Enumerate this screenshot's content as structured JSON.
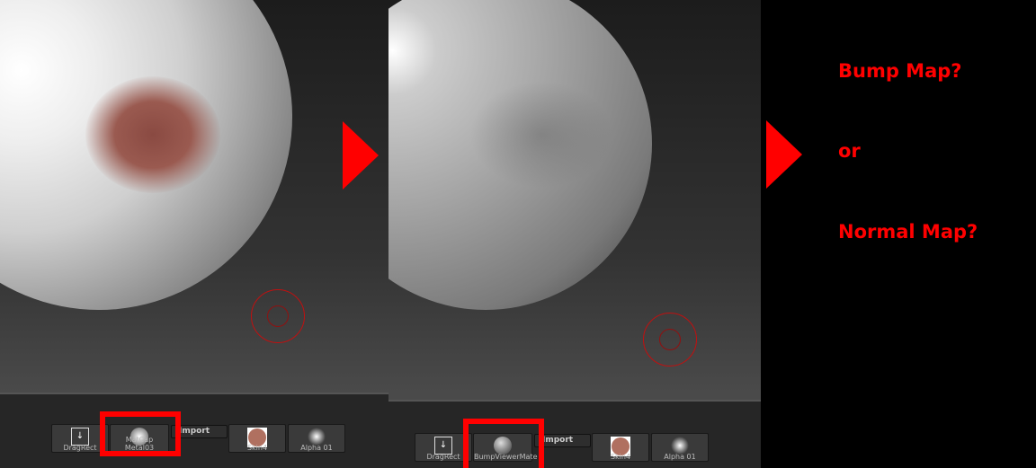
{
  "left_viewport": {
    "buttons": [
      {
        "label": "DragRect",
        "icon": "drag-rect-icon"
      },
      {
        "label": "MatCap  Metal03",
        "icon": "material-sphere-icon"
      },
      {
        "label": "Import"
      },
      {
        "label": "Skin4",
        "icon": "skin-texture-icon"
      },
      {
        "label": "Alpha  01",
        "icon": "alpha-icon"
      }
    ]
  },
  "right_viewport": {
    "buttons": [
      {
        "label": "DragRect",
        "icon": "drag-rect-icon"
      },
      {
        "label": "BumpViewerMate",
        "icon": "material-sphere-icon"
      },
      {
        "label": "Import"
      },
      {
        "label": "Skin4",
        "icon": "skin-texture-icon"
      },
      {
        "label": "Alpha  01",
        "icon": "alpha-icon"
      }
    ]
  },
  "questions": [
    "Bump Map?",
    "or",
    "Normal Map?"
  ],
  "colors": {
    "accent": "#ff0000"
  }
}
